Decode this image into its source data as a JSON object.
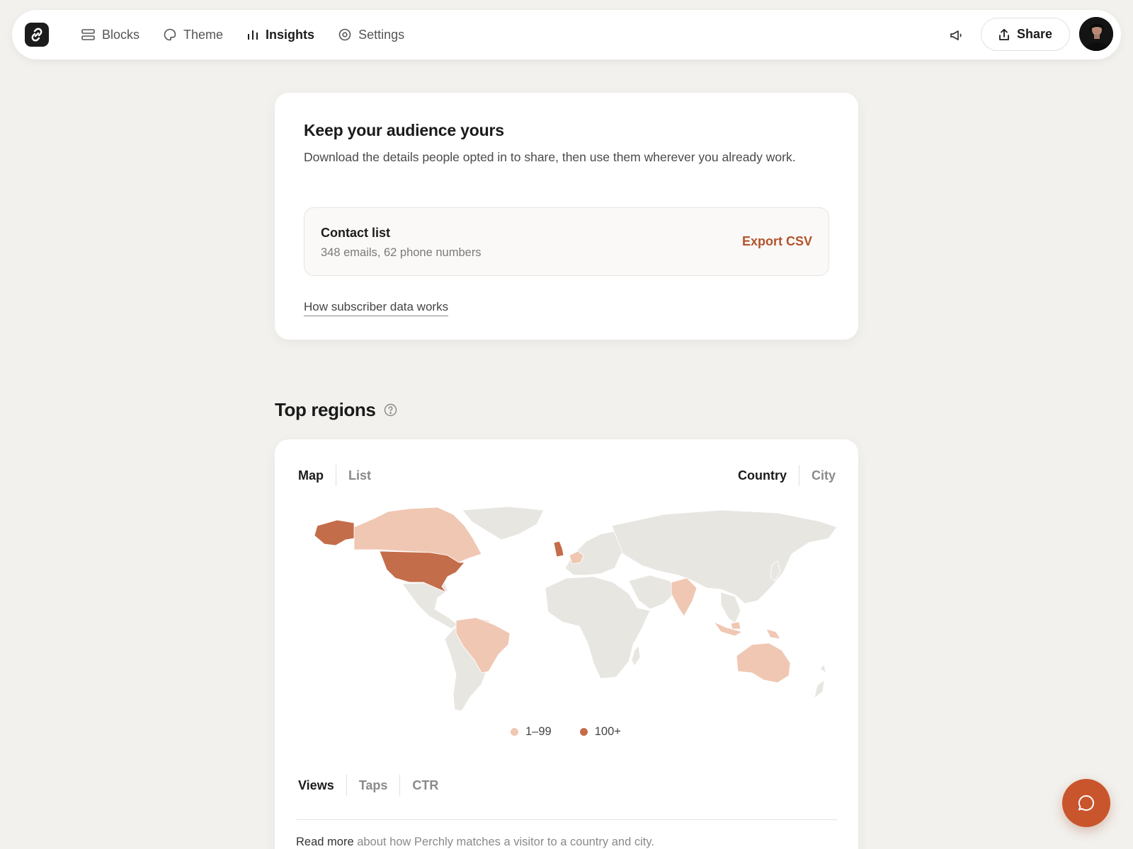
{
  "nav": {
    "items": [
      {
        "label": "Blocks",
        "icon": "blocks-icon",
        "active": false
      },
      {
        "label": "Theme",
        "icon": "palette-icon",
        "active": false
      },
      {
        "label": "Insights",
        "icon": "bar-chart-icon",
        "active": true
      },
      {
        "label": "Settings",
        "icon": "gear-icon",
        "active": false
      }
    ],
    "share_label": "Share"
  },
  "audience": {
    "title": "Keep your audience yours",
    "description": "Download the details people opted in to share, then use them wherever you already work.",
    "contact_title": "Contact list",
    "contact_summary": "348 emails, 62 phone numbers",
    "export_label": "Export CSV",
    "help_link": "How subscriber data works"
  },
  "regions": {
    "title": "Top regions",
    "view_tabs": [
      {
        "label": "Map",
        "selected": true
      },
      {
        "label": "List",
        "selected": false
      }
    ],
    "scope_tabs": [
      {
        "label": "Country",
        "selected": true
      },
      {
        "label": "City",
        "selected": false
      }
    ],
    "legend": [
      {
        "label": "1–99",
        "color": "#f0c7b3"
      },
      {
        "label": "100+",
        "color": "#c46d4b"
      }
    ],
    "metric_tabs": [
      {
        "label": "Views",
        "selected": true
      },
      {
        "label": "Taps",
        "selected": false
      },
      {
        "label": "CTR",
        "selected": false
      }
    ],
    "footnote_link": "Read more",
    "footnote_rest": " about how Perchly matches a visitor to a country and city."
  },
  "colors": {
    "accent": "#b3542c",
    "map_empty": "#e8e6e1",
    "map_low": "#f0c7b3",
    "map_high": "#c46d4b",
    "fab": "#c9552d"
  }
}
